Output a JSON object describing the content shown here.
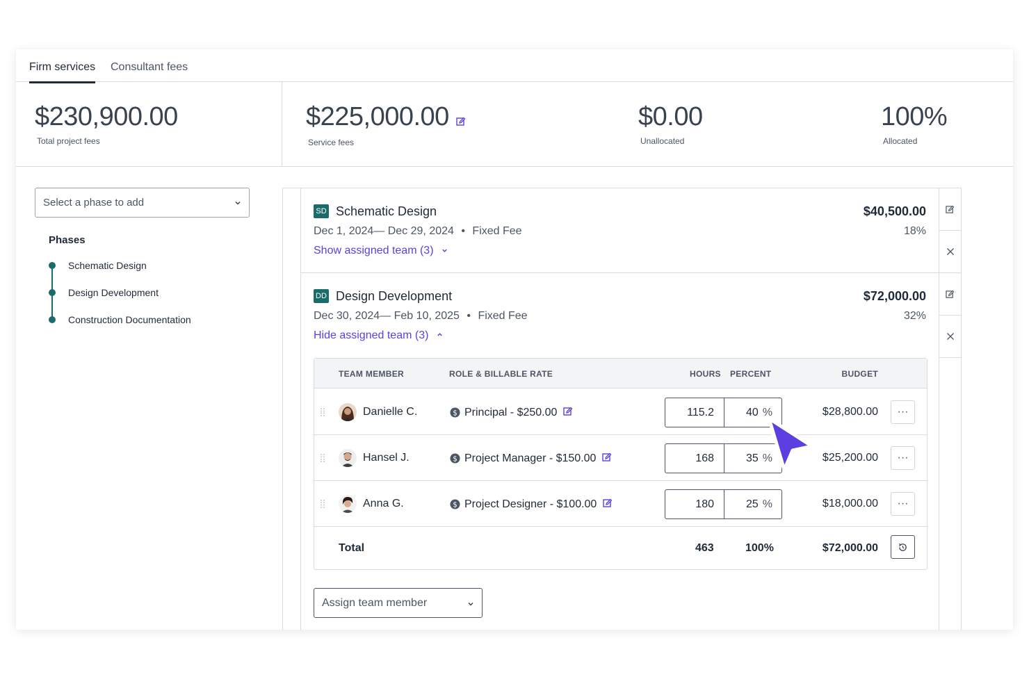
{
  "tabs": [
    {
      "label": "Firm services",
      "active": true
    },
    {
      "label": "Consultant fees",
      "active": false
    }
  ],
  "summary": {
    "total_fees": {
      "value": "$230,900.00",
      "label": "Total project fees"
    },
    "service_fees": {
      "value": "$225,000.00",
      "label": "Service fees"
    },
    "unallocated": {
      "value": "$0.00",
      "label": "Unallocated"
    },
    "allocated": {
      "value": "100%",
      "label": "Allocated"
    }
  },
  "phase_select": {
    "placeholder": "Select a phase to add"
  },
  "phases_nav": {
    "title": "Phases",
    "items": [
      "Schematic Design",
      "Design Development",
      "Construction Documentation"
    ]
  },
  "phase_sd": {
    "badge": "SD",
    "title": "Schematic Design",
    "dates": "Dec 1, 2024— Dec 29, 2024",
    "fee_type": "Fixed Fee",
    "link": "Show assigned team (3)",
    "amount": "$40,500.00",
    "percent": "18%"
  },
  "phase_dd": {
    "badge": "DD",
    "title": "Design Development",
    "dates": "Dec 30, 2024— Feb 10, 2025",
    "fee_type": "Fixed Fee",
    "link": "Hide assigned team (3)",
    "amount": "$72,000.00",
    "percent": "32%"
  },
  "team_table": {
    "headers": {
      "member": "TEAM MEMBER",
      "role": "ROLE & BILLABLE RATE",
      "hours": "HOURS",
      "percent": "PERCENT",
      "budget": "BUDGET"
    },
    "rows": [
      {
        "member": "Danielle C.",
        "role": "Principal - $250.00",
        "hours": "115.2",
        "percent": "40",
        "budget": "$28,800.00"
      },
      {
        "member": "Hansel J.",
        "role": "Project Manager - $150.00",
        "hours": "168",
        "percent": "35",
        "budget": "$25,200.00"
      },
      {
        "member": "Anna G.",
        "role": "Project Designer - $100.00",
        "hours": "180",
        "percent": "25",
        "budget": "$18,000.00"
      }
    ],
    "total": {
      "label": "Total",
      "hours": "463",
      "percent": "100%",
      "budget": "$72,000.00"
    },
    "percent_sign": "%",
    "more_glyph": "···"
  },
  "assign": {
    "label": "Assign team member"
  },
  "separator": "•",
  "colors": {
    "accent": "#5b3fe0",
    "teal": "#1b6b6b",
    "text": "#1f2937"
  }
}
